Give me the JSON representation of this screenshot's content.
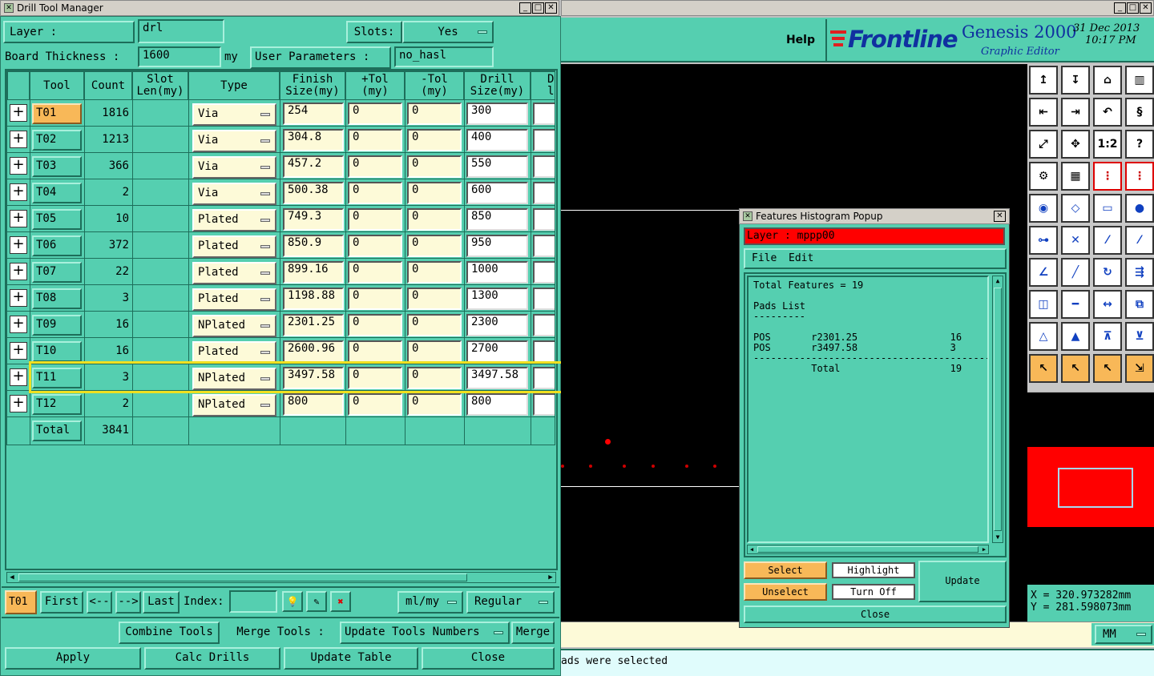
{
  "left_window": {
    "title": "Drill Tool Manager",
    "layer_label": "Layer :",
    "layer_value": "drl",
    "slots_label": "Slots:",
    "slots_value": "Yes",
    "board_thickness_label": "Board Thickness :",
    "board_thickness_value": "1600",
    "board_thickness_unit": "my",
    "user_params_label": "User Parameters :",
    "user_params_value": "no_hasl",
    "columns": [
      "Tool",
      "Count",
      "Slot\nLen(my)",
      "Type",
      "Finish\nSize(my)",
      "+Tol\n(my)",
      "-Tol\n(my)",
      "Drill\nSize(my)",
      "Dr\nl"
    ],
    "rows": [
      {
        "tool": "T01",
        "count": "1816",
        "type": "Via",
        "finish": "254",
        "ptol": "0",
        "ntol": "0",
        "drill": "300"
      },
      {
        "tool": "T02",
        "count": "1213",
        "type": "Via",
        "finish": "304.8",
        "ptol": "0",
        "ntol": "0",
        "drill": "400"
      },
      {
        "tool": "T03",
        "count": "366",
        "type": "Via",
        "finish": "457.2",
        "ptol": "0",
        "ntol": "0",
        "drill": "550"
      },
      {
        "tool": "T04",
        "count": "2",
        "type": "Via",
        "finish": "500.38",
        "ptol": "0",
        "ntol": "0",
        "drill": "600"
      },
      {
        "tool": "T05",
        "count": "10",
        "type": "Plated",
        "finish": "749.3",
        "ptol": "0",
        "ntol": "0",
        "drill": "850"
      },
      {
        "tool": "T06",
        "count": "372",
        "type": "Plated",
        "finish": "850.9",
        "ptol": "0",
        "ntol": "0",
        "drill": "950"
      },
      {
        "tool": "T07",
        "count": "22",
        "type": "Plated",
        "finish": "899.16",
        "ptol": "0",
        "ntol": "0",
        "drill": "1000"
      },
      {
        "tool": "T08",
        "count": "3",
        "type": "Plated",
        "finish": "1198.88",
        "ptol": "0",
        "ntol": "0",
        "drill": "1300"
      },
      {
        "tool": "T09",
        "count": "16",
        "type": "NPlated",
        "finish": "2301.25",
        "ptol": "0",
        "ntol": "0",
        "drill": "2300"
      },
      {
        "tool": "T10",
        "count": "16",
        "type": "Plated",
        "finish": "2600.96",
        "ptol": "0",
        "ntol": "0",
        "drill": "2700"
      },
      {
        "tool": "T11",
        "count": "3",
        "type": "NPlated",
        "finish": "3497.58",
        "ptol": "0",
        "ntol": "0",
        "drill": "3497.58"
      },
      {
        "tool": "T12",
        "count": "2",
        "type": "NPlated",
        "finish": "800",
        "ptol": "0",
        "ntol": "0",
        "drill": "800"
      }
    ],
    "total_label": "Total",
    "total_count": "3841",
    "nav": {
      "current_tool": "T01",
      "first": "First",
      "prev": "<--",
      "next": "-->",
      "last": "Last",
      "index_label": "Index:",
      "units": "ml/my",
      "mode": "Regular"
    },
    "actions": {
      "combine": "Combine Tools",
      "merge_label": "Merge Tools :",
      "update_numbers": "Update Tools Numbers",
      "merge": "Merge",
      "apply": "Apply",
      "calc": "Calc Drills",
      "update_table": "Update Table",
      "close": "Close"
    }
  },
  "right_app": {
    "help": "Help",
    "brand": "Frontline",
    "product": "Genesis 2000",
    "subtitle": "Graphic Editor",
    "date": "31 Dec 2013",
    "time": "10:17 PM",
    "coord_x": "X = 320.973282mm",
    "coord_y": "Y = 281.598073mm",
    "units": "MM",
    "status": "ads were selected"
  },
  "popup": {
    "title": "Features Histogram Popup",
    "layer_text": "Layer : mppp00",
    "menu_file": "File",
    "menu_edit": "Edit",
    "report_lines": [
      "Total Features = 19",
      "",
      "Pads List",
      "---------",
      "",
      "POS       r2301.25                16",
      "POS       r3497.58                3",
      "------------------------------------------------",
      "          Total                   19"
    ],
    "select": "Select",
    "unselect": "Unselect",
    "highlight": "Highlight",
    "turn_off": "Turn Off",
    "update": "Update",
    "close": "Close"
  },
  "colors": {
    "teal": "#55cfb0",
    "orange": "#f8b858",
    "highlight": "#f0e020",
    "red": "#ff0000"
  }
}
